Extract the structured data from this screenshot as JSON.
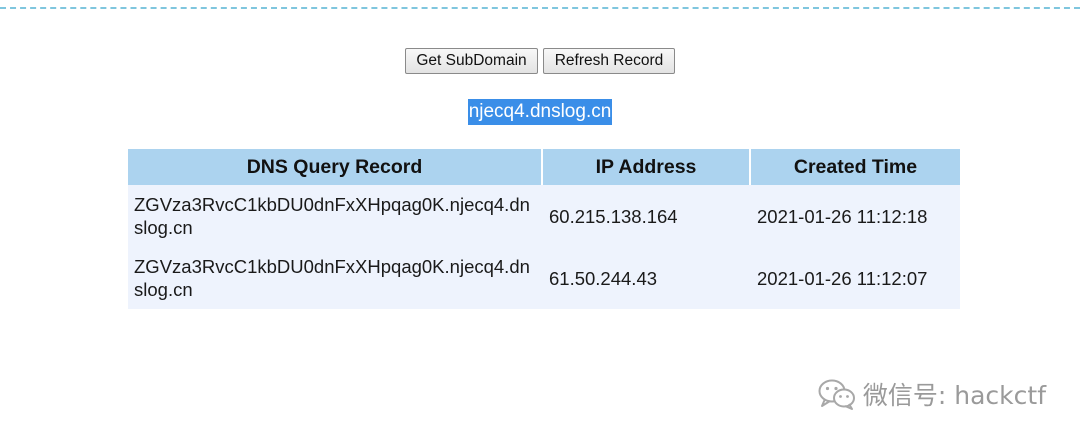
{
  "toolbar": {
    "get_subdomain_label": "Get SubDomain",
    "refresh_record_label": "Refresh Record"
  },
  "subdomain": {
    "value": "njecq4.dnslog.cn"
  },
  "records_table": {
    "headers": [
      "DNS Query Record",
      "IP Address",
      "Created Time"
    ],
    "rows": [
      {
        "dns_query": "ZGVza3RvcC1kbDU0dnFxXHpqag0K.njecq4.dnslog.cn",
        "ip_address": "60.215.138.164",
        "created_time": "2021-01-26 11:12:18"
      },
      {
        "dns_query": "ZGVza3RvcC1kbDU0dnFxXHpqag0K.njecq4.dnslog.cn",
        "ip_address": "61.50.244.43",
        "created_time": "2021-01-26 11:12:07"
      }
    ]
  },
  "watermark": {
    "text": "微信号: hackctf",
    "icon": "wechat-logo-icon"
  },
  "colors": {
    "divider": "#7fc6de",
    "selection_highlight": "#3a8ee8",
    "table_header_bg": "#acd3ef",
    "table_row_bg": "#eef3fd"
  }
}
